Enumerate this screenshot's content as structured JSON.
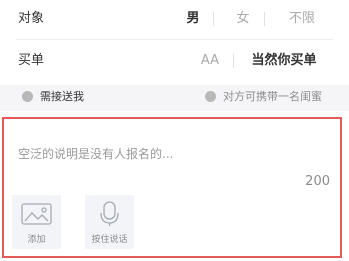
{
  "gender_row": {
    "label": "对象",
    "options": [
      {
        "label": "男",
        "selected": true
      },
      {
        "label": "女",
        "selected": false
      },
      {
        "label": "不限",
        "selected": false
      }
    ]
  },
  "pay_row": {
    "label": "买单",
    "options": [
      {
        "label": "AA",
        "selected": false
      },
      {
        "label": "当然你买单",
        "selected": true
      }
    ]
  },
  "extra_options": [
    {
      "label": "需接送我",
      "checked": false
    },
    {
      "label": "对方可携带一名闺蜜",
      "checked": false
    }
  ],
  "description": {
    "placeholder": "空泛的说明是没有人报名的...",
    "char_limit": "200",
    "attachments": [
      {
        "label": "添加",
        "icon": "image-icon"
      },
      {
        "label": "按住说话",
        "icon": "microphone-icon"
      }
    ]
  },
  "colors": {
    "accent_border": "#e35b58",
    "option_bar_bg": "#f5f5f7",
    "tile_bg": "#f2f4f8"
  }
}
